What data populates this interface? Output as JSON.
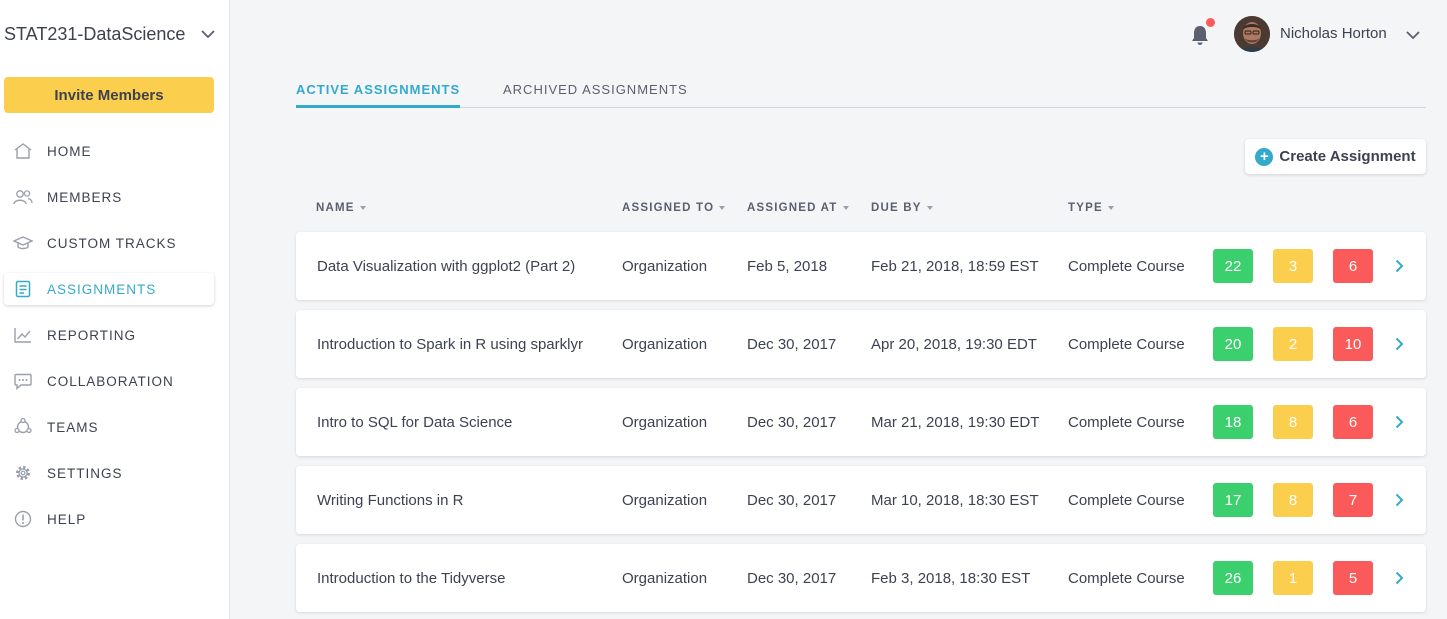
{
  "sidebar": {
    "org_name": "STAT231-DataScience",
    "invite_label": "Invite Members",
    "items": [
      {
        "label": "HOME",
        "icon": "home-icon"
      },
      {
        "label": "MEMBERS",
        "icon": "members-icon"
      },
      {
        "label": "CUSTOM TRACKS",
        "icon": "graduation-cap-icon"
      },
      {
        "label": "ASSIGNMENTS",
        "icon": "clipboard-icon",
        "active": true
      },
      {
        "label": "REPORTING",
        "icon": "line-chart-icon"
      },
      {
        "label": "COLLABORATION",
        "icon": "chat-icon"
      },
      {
        "label": "TEAMS",
        "icon": "teams-icon"
      },
      {
        "label": "SETTINGS",
        "icon": "gear-icon"
      },
      {
        "label": "HELP",
        "icon": "info-icon"
      }
    ]
  },
  "header": {
    "user_name": "Nicholas Horton",
    "notification_dot": true
  },
  "tabs": [
    {
      "label": "ACTIVE ASSIGNMENTS",
      "active": true
    },
    {
      "label": "ARCHIVED ASSIGNMENTS",
      "active": false
    }
  ],
  "create_label": "Create Assignment",
  "columns": {
    "name": "NAME",
    "assigned_to": "ASSIGNED TO",
    "assigned_at": "ASSIGNED AT",
    "due_by": "DUE BY",
    "type": "TYPE"
  },
  "assignments": [
    {
      "name": "Data Visualization with ggplot2 (Part 2)",
      "assigned_to": "Organization",
      "assigned_at": "Feb 5, 2018",
      "due_by": "Feb 21, 2018, 18:59 EST",
      "type": "Complete Course",
      "green": "22",
      "yellow": "3",
      "red": "6"
    },
    {
      "name": "Introduction to Spark in R using sparklyr",
      "assigned_to": "Organization",
      "assigned_at": "Dec 30, 2017",
      "due_by": "Apr 20, 2018, 19:30 EDT",
      "type": "Complete Course",
      "green": "20",
      "yellow": "2",
      "red": "10"
    },
    {
      "name": "Intro to SQL for Data Science",
      "assigned_to": "Organization",
      "assigned_at": "Dec 30, 2017",
      "due_by": "Mar 21, 2018, 19:30 EDT",
      "type": "Complete Course",
      "green": "18",
      "yellow": "8",
      "red": "6"
    },
    {
      "name": "Writing Functions in R",
      "assigned_to": "Organization",
      "assigned_at": "Dec 30, 2017",
      "due_by": "Mar 10, 2018, 18:30 EST",
      "type": "Complete Course",
      "green": "17",
      "yellow": "8",
      "red": "7"
    },
    {
      "name": "Introduction to the Tidyverse",
      "assigned_to": "Organization",
      "assigned_at": "Dec 30, 2017",
      "due_by": "Feb 3, 2018, 18:30 EST",
      "type": "Complete Course",
      "green": "26",
      "yellow": "1",
      "red": "5"
    }
  ],
  "colors": {
    "accent": "#33aacc",
    "invite": "#fcce4e",
    "green": "#3ccf6e",
    "yellow": "#fcce4e",
    "red": "#fb5a5a"
  }
}
